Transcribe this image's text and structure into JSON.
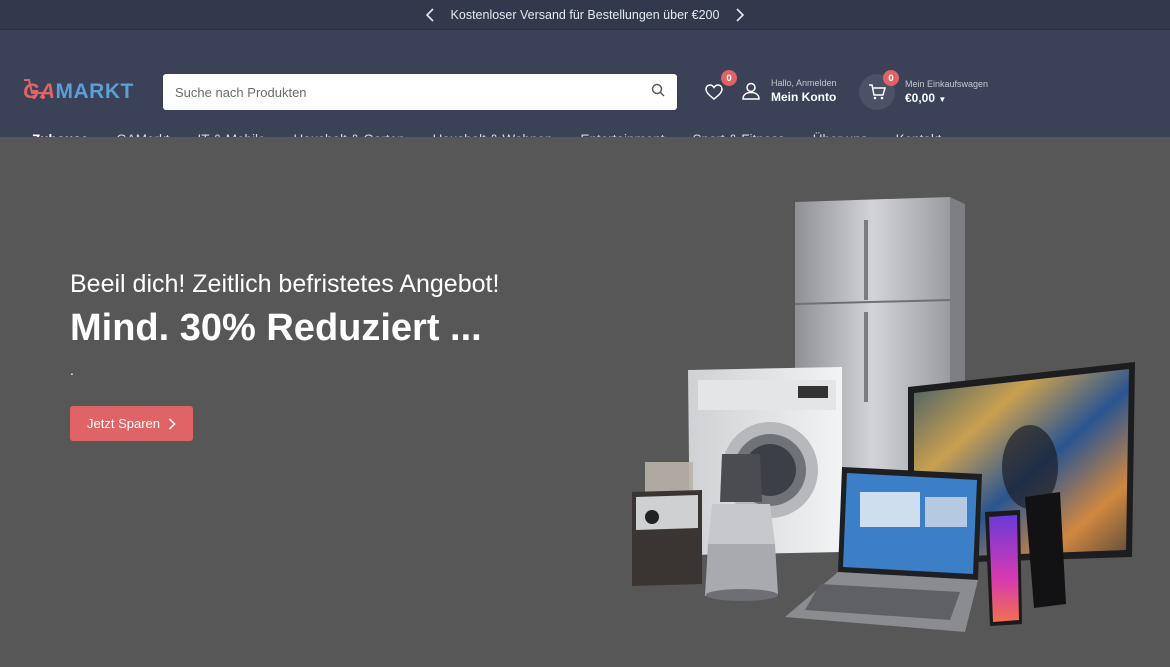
{
  "promo": {
    "text": "Kostenloser Versand für Bestellungen über €200"
  },
  "header": {
    "logo": {
      "part1": "GA",
      "part2": "MARKT"
    },
    "search": {
      "placeholder": "Suche nach Produkten"
    },
    "wishlist": {
      "count": "0"
    },
    "account": {
      "greeting": "Hallo, Anmelden",
      "label": "Mein Konto"
    },
    "cart": {
      "count": "0",
      "label": "Mein Einkaufswagen",
      "total": "€0,00"
    }
  },
  "nav": {
    "items": [
      {
        "label": "Zuhouse"
      },
      {
        "label": "GAMarkt"
      },
      {
        "label": "IT & Mobile"
      },
      {
        "label": "Haushalt & Garten"
      },
      {
        "label": "Haushalt & Wohnen"
      },
      {
        "label": "Entertainment"
      },
      {
        "label": "Sport & Fitness"
      },
      {
        "label": "Über uns"
      },
      {
        "label": "Kontakt"
      }
    ]
  },
  "hero": {
    "subtitle": "Beeil dich! Zeitlich befristetes Angebot!",
    "title": "Mind. 30% Reduziert ...",
    "dot": ".",
    "cta": "Jetzt Sparen"
  },
  "colors": {
    "accent": "#e06466",
    "header_bg": "#3b4156",
    "promo_bg": "#33394d",
    "hero_bg": "#575757",
    "logo_blue": "#5a9fd8"
  }
}
